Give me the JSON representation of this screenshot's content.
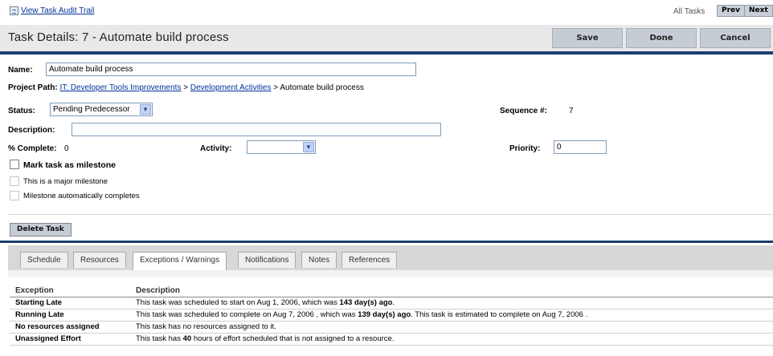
{
  "topbar": {
    "audit_link": "View Task Audit Trail",
    "all_tasks": "All Tasks",
    "prev_label": "Prev",
    "next_label": "Next"
  },
  "header": {
    "title": "Task Details: 7 - Automate build process",
    "save_label": "Save",
    "done_label": "Done",
    "cancel_label": "Cancel"
  },
  "form": {
    "name_label": "Name:",
    "name_value": "Automate build process",
    "project_path_label": "Project Path:",
    "path_link_1": "IT: Developer Tools Improvements",
    "path_sep_1": " > ",
    "path_link_2": "Development Activities",
    "path_sep_2": " > ",
    "path_end": "Automate build process",
    "status_label": "Status:",
    "status_value": "Pending Predecessor",
    "sequence_label": "Sequence #:",
    "sequence_value": "7",
    "description_label": "Description:",
    "description_value": "",
    "complete_label": "% Complete:",
    "complete_value": "0",
    "activity_label": "Activity:",
    "activity_value": "",
    "priority_label": "Priority:",
    "priority_value": "0",
    "milestone_label": "Mark task as milestone",
    "major_milestone_label": "This is a major milestone",
    "auto_complete_label": "Milestone automatically completes",
    "delete_label": "Delete Task"
  },
  "tabs": [
    {
      "label": "Schedule"
    },
    {
      "label": "Resources"
    },
    {
      "label": "Exceptions / Warnings"
    },
    {
      "label": "Notifications"
    },
    {
      "label": "Notes"
    },
    {
      "label": "References"
    }
  ],
  "exceptions": {
    "col_exception": "Exception",
    "col_description": "Description",
    "rows": [
      {
        "name": "Starting Late",
        "pre": "This task was scheduled to start on Aug 1, 2006, which was ",
        "bold": "143 day(s) ago",
        "post": "."
      },
      {
        "name": "Running Late",
        "pre": "This task was scheduled to complete on Aug 7, 2006 , which was ",
        "bold": "139 day(s) ago",
        "post": ". This task is estimated to complete on Aug 7, 2006 ."
      },
      {
        "name": "No resources assigned",
        "pre": "This task has no resources assigned to it.",
        "bold": "",
        "post": ""
      },
      {
        "name": "Unassigned Effort",
        "pre": "This task has ",
        "bold": "40",
        "post": " hours of effort scheduled that is not assigned to a resource."
      }
    ]
  },
  "colors": {
    "accent_rule": "#1c3f70",
    "link": "#003399",
    "button_bg": "#c6ccd4"
  }
}
